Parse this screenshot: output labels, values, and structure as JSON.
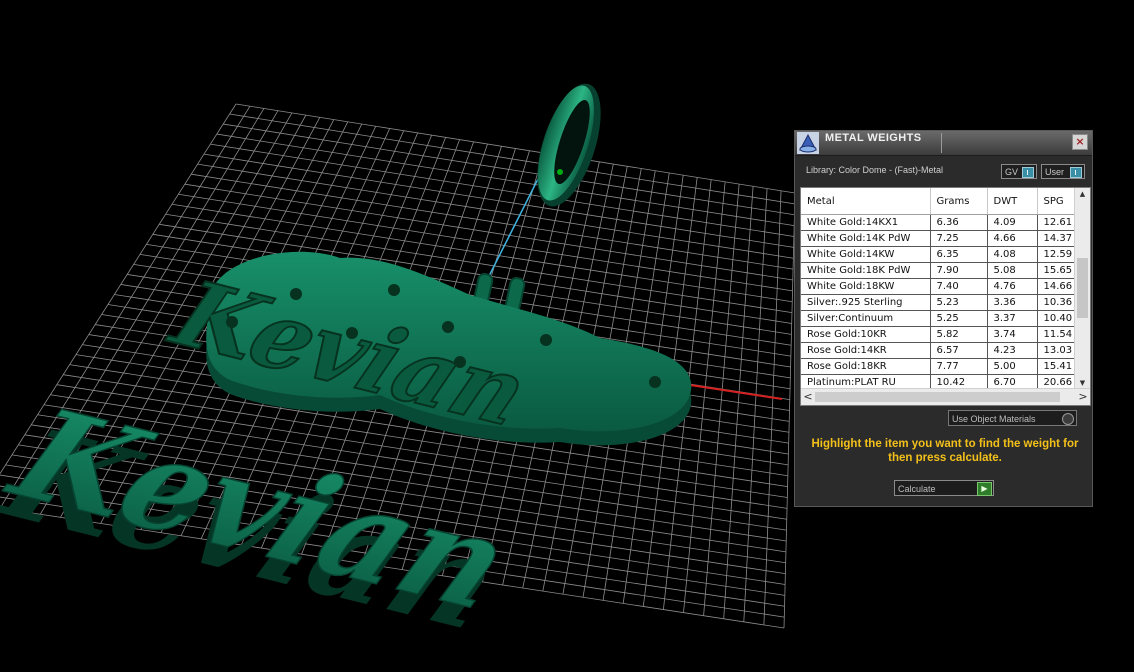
{
  "scene": {
    "model_text_raised": "Kevian",
    "model_text_front": "Kevian",
    "colors": {
      "background": "#000000",
      "grid": "#9a9a9a",
      "metal": "#0e6e4e",
      "metal_shadow": "#064431",
      "axis_x": "#d62020",
      "axis_link": "#3fb4e0"
    }
  },
  "panel": {
    "title": "METAL WEIGHTS",
    "title_icon": "dome-icon",
    "close_icon": "close-icon",
    "close_glyph": "×",
    "library": "Library: Color Dome - (Fast)-Metal",
    "toggles": {
      "gv": "GV",
      "user": "User"
    },
    "columns": [
      "Metal",
      "Grams",
      "DWT",
      "SPG"
    ],
    "rows": [
      [
        "White Gold:14KX1",
        "6.36",
        "4.09",
        "12.61"
      ],
      [
        "White Gold:14K PdW",
        "7.25",
        "4.66",
        "14.37"
      ],
      [
        "White Gold:14KW",
        "6.35",
        "4.08",
        "12.59"
      ],
      [
        "White Gold:18K PdW",
        "7.90",
        "5.08",
        "15.65"
      ],
      [
        "White Gold:18KW",
        "7.40",
        "4.76",
        "14.66"
      ],
      [
        "Silver:.925 Sterling",
        "5.23",
        "3.36",
        "10.36"
      ],
      [
        "Silver:Continuum",
        "5.25",
        "3.37",
        "10.40"
      ],
      [
        "Rose Gold:10KR",
        "5.82",
        "3.74",
        "11.54"
      ],
      [
        "Rose Gold:14KR",
        "6.57",
        "4.23",
        "13.03"
      ],
      [
        "Rose Gold:18KR",
        "7.77",
        "5.00",
        "15.41"
      ],
      [
        "Platinum:PLAT RU",
        "10.42",
        "6.70",
        "20.66"
      ]
    ],
    "scroll": {
      "up": "▲",
      "down": "▼",
      "left": "<",
      "right": ">"
    },
    "materials_option": "Use Object Materials",
    "hint": "Highlight the item you want to find the weight for then press calculate.",
    "calculate": "Calculate",
    "calculate_glyph": "▶",
    "accent": "#f3c01a"
  }
}
